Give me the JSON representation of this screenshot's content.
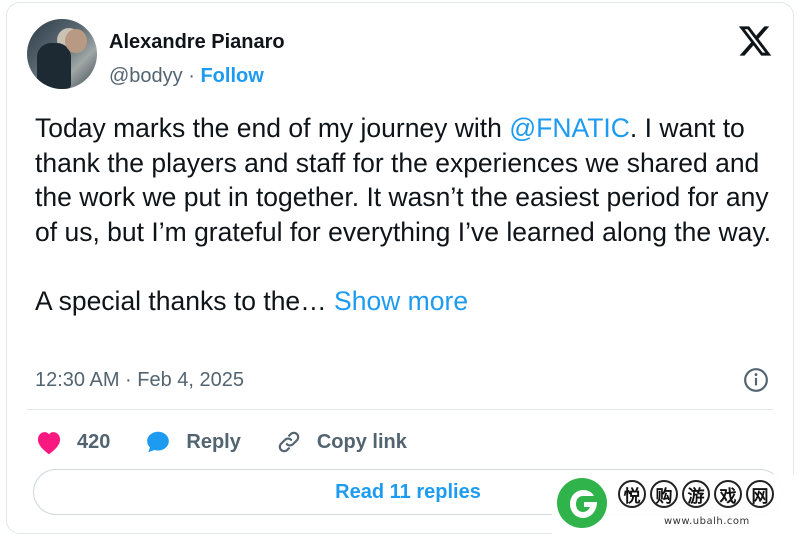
{
  "author": {
    "name": "Alexandre Pianaro",
    "handle": "@bodyy",
    "separator": " · ",
    "follow_label": "Follow"
  },
  "tweet": {
    "text_before_mention": "Today marks the end of my journey with ",
    "mention": "@FNATIC",
    "text_after_mention": ". I want to thank the players and staff for the experiences we shared and the work we put in together. It wasn’t the easiest period for any of us, but I’m grateful for everything I’ve learned along the way.\n\nA special thanks to the… ",
    "show_more_label": "Show more",
    "timestamp": "12:30 AM · Feb 4, 2025"
  },
  "actions": {
    "like_count": "420",
    "reply_label": "Reply",
    "copy_link_label": "Copy link"
  },
  "replies": {
    "read_label": "Read 11 replies"
  },
  "watermark": {
    "chars": [
      "悦",
      "购",
      "游",
      "戏",
      "网"
    ],
    "url": "www.ubalh.com"
  },
  "colors": {
    "accent": "#1d9bf0",
    "like": "#f91880",
    "text": "#0f1419",
    "muted": "#536471"
  },
  "icons": [
    "x-logo-icon",
    "info-icon",
    "heart-icon",
    "reply-bubble-icon",
    "link-icon"
  ]
}
